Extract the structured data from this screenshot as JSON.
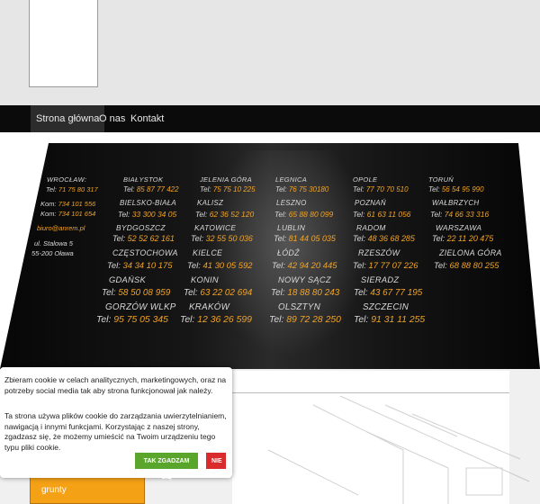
{
  "nav": {
    "items": [
      {
        "label": "Strona główna"
      },
      {
        "label": "O nas"
      },
      {
        "label": "Kontakt"
      }
    ]
  },
  "wroclaw": {
    "city": "WROCŁAW:",
    "tel_prefix": "Tel:",
    "tel": "71 75 80 317",
    "kom_prefix": "Kom:",
    "kom1": "734 101 556",
    "kom2": "734 101 654",
    "email": "biuro@anrem.pl",
    "street": "ul. Stalowa 5",
    "postcode": "55-200 Oława"
  },
  "offices": [
    {
      "city": "BIAŁYSTOK",
      "tel": "85 87 77 422"
    },
    {
      "city": "JELENIA GÓRA",
      "tel": "75 75 10 225"
    },
    {
      "city": "LEGNICA",
      "tel": "76 75 30180"
    },
    {
      "city": "OPOLE",
      "tel": "77 70 70 510"
    },
    {
      "city": "TORUŃ",
      "tel": "56 54 95 990"
    },
    {
      "city": "BIELSKO-BIAŁA",
      "tel": "33 300 34 05"
    },
    {
      "city": "KALISZ",
      "tel": "62 36 52 120"
    },
    {
      "city": "LESZNO",
      "tel": "65 88 80 099"
    },
    {
      "city": "POZNAŃ",
      "tel": "61 63 11 056"
    },
    {
      "city": "WAŁBRZYCH",
      "tel": "74 66 33 316"
    },
    {
      "city": "BYDGOSZCZ",
      "tel": "52 52 62 161"
    },
    {
      "city": "KATOWICE",
      "tel": "32 55 50 036"
    },
    {
      "city": "LUBLIN",
      "tel": "81 44 05 035"
    },
    {
      "city": "RADOM",
      "tel": "48 36 68 285"
    },
    {
      "city": "WARSZAWA",
      "tel": "22 11 20 475"
    },
    {
      "city": "CZĘSTOCHOWA",
      "tel": "34 34 10 175"
    },
    {
      "city": "KIELCE",
      "tel": "41 30 05 592"
    },
    {
      "city": "ŁÓDŹ",
      "tel": "42 94 20 445"
    },
    {
      "city": "RZESZÓW",
      "tel": "17 77 07 226"
    },
    {
      "city": "ZIELONA GÓRA",
      "tel": "68 88 80 255"
    },
    {
      "city": "GDAŃSK",
      "tel": "58 50 08 959"
    },
    {
      "city": "KONIN",
      "tel": "63 22 02 694"
    },
    {
      "city": "NOWY SĄCZ",
      "tel": "18 88 80 243"
    },
    {
      "city": "SIERADZ",
      "tel": "43 67 77 195"
    },
    {
      "city": "GORZÓW WLKP",
      "tel": "95 75 05 345"
    },
    {
      "city": "KRAKÓW",
      "tel": "12 36 26 599"
    },
    {
      "city": "OLSZTYN",
      "tel": "89 72 28 250"
    },
    {
      "city": "SZCZECIN",
      "tel": "91 31 11 255"
    }
  ],
  "tel_label": "Tel:",
  "side": {
    "button_label": "grunty"
  },
  "cookie": {
    "text1": "Zbieram cookie w celach analitycznych, marketingowych, oraz na potrzeby social media tak aby strona funkcjonował jak należy.",
    "text2": "Ta strona używa plików cookie do zarządzania uwierzytelnianiem, nawigacją i innymi funkcjami. Korzystając z naszej strony, zgadzasz się, że możemy umieścić na Twoim urządzeniu tego typu pliki cookie.",
    "accept_label": "TAK ZGADZAM SIĘ",
    "reject_label": "NIE"
  },
  "colors": {
    "accent": "#f1a326",
    "nav_bg": "#0b0b0b",
    "accept": "#5aa62d",
    "reject": "#d92b2b"
  }
}
